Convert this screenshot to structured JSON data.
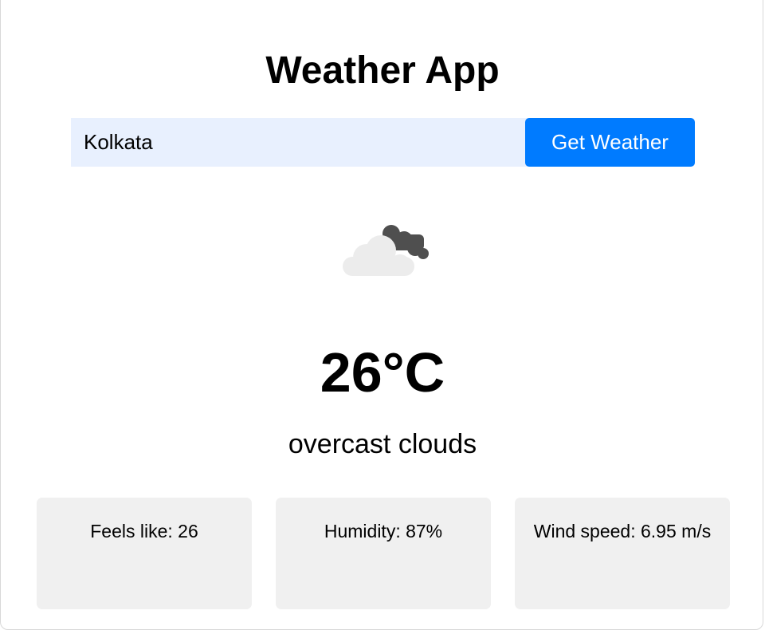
{
  "app": {
    "title": "Weather App"
  },
  "search": {
    "value": "Kolkata",
    "button_label": "Get Weather"
  },
  "weather": {
    "icon": "broken-clouds-icon",
    "temperature": "26°C",
    "description": "overcast clouds"
  },
  "details": {
    "feels_like": "Feels like: 26",
    "humidity": "Humidity: 87%",
    "wind_speed": "Wind speed: 6.95 m/s"
  },
  "colors": {
    "accent": "#007bff",
    "input_bg": "#e8f0fe",
    "card_bg": "#f0f0f0"
  }
}
